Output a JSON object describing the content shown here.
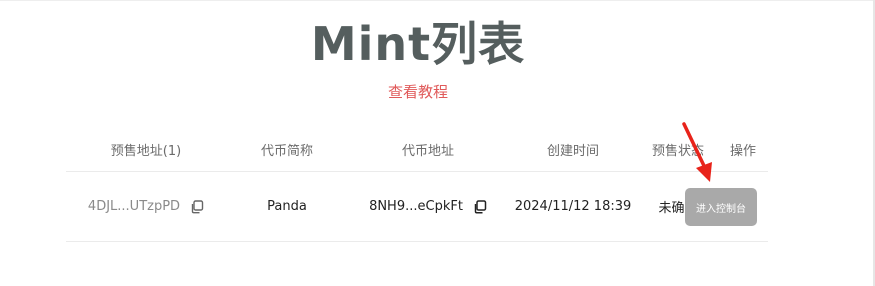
{
  "title": "Mint列表",
  "tutorial_link": "查看教程",
  "table": {
    "headers": [
      "预售地址(1)",
      "代币简称",
      "代币地址",
      "创建时间",
      "预售状态",
      "操作"
    ],
    "rows": [
      {
        "presale_address": "4DJL...UTzpPD",
        "token_symbol": "Panda",
        "token_address": "8NH9...eCpkFt",
        "created_at": "2024/11/12 18:39",
        "presale_status": "未确认",
        "action_label": "进入控制台"
      }
    ]
  },
  "colors": {
    "title": "#555e5e",
    "link": "#e05a5a",
    "button_bg": "#a9a9a9",
    "arrow": "#e8231a"
  },
  "icons": [
    "copy-icon",
    "red-arrow-pointer"
  ]
}
